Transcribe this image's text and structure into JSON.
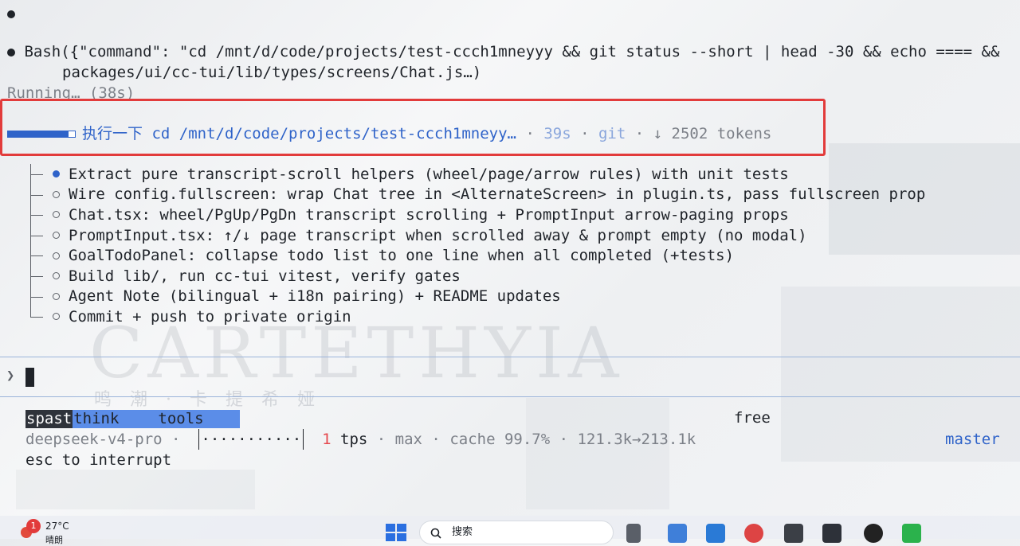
{
  "transcript": {
    "bash_call": "Bash({\"command\": \"cd /mnt/d/code/projects/test-ccch1mneyyy && git status --short | head -30 && echo ==== && ",
    "bash_call_cont": "packages/ui/cc-tui/lib/types/screens/Chat.js…)",
    "running": "Running… (38s)"
  },
  "task": {
    "title": "执行一下 cd /mnt/d/code/projects/test-ccch1mneyy…",
    "sep1": " · ",
    "elapsed": "39s",
    "sep2": " · ",
    "tool": "git",
    "sep3": " · ",
    "tokens": "↓ 2502 tokens"
  },
  "todos": [
    {
      "text": "Extract pure transcript-scroll helpers (wheel/page/arrow rules) with unit tests",
      "status": "active"
    },
    {
      "text": "Wire config.fullscreen: wrap Chat tree in <AlternateScreen> in plugin.ts, pass fullscreen prop",
      "status": "pending"
    },
    {
      "text": "Chat.tsx: wheel/PgUp/PgDn transcript scrolling + PromptInput arrow-paging props",
      "status": "pending"
    },
    {
      "text": "PromptInput.tsx: ↑/↓ page transcript when scrolled away & prompt empty (no modal)",
      "status": "pending"
    },
    {
      "text": "GoalTodoPanel: collapse todo list to one line when all completed (+tests)",
      "status": "pending"
    },
    {
      "text": "Build lib/, run cc-tui vitest, verify gates",
      "status": "pending"
    },
    {
      "text": "Agent Note (bilingual + i18n pairing) + README updates",
      "status": "pending"
    },
    {
      "text": "Commit + push to private origin",
      "status": "pending"
    }
  ],
  "prompt": {
    "caret": "❯"
  },
  "status": {
    "mode": "spast",
    "think": "think",
    "tools": "tools",
    "plan": "free",
    "model": "deepseek-v4-pro",
    "sep": " · ",
    "sparkline": "···········",
    "tps_value": "1",
    "tps_label": " tps",
    "effort": "max",
    "cache_label": "cache",
    "cache_value": " 99.7%",
    "context": "121.3k→213.1k",
    "branch": "master",
    "hint": "esc to interrupt"
  },
  "background": {
    "title": "CARTETHYIA",
    "subtitle": "鸣 潮 · 卡 提 希 娅"
  },
  "taskbar": {
    "badge": "1",
    "temperature": "27°C",
    "weather": "晴朗",
    "search_placeholder": "搜索"
  },
  "colors": {
    "accent": "#2f63c9",
    "highlight_border": "#e23b3b",
    "tps": "#e5484d"
  }
}
